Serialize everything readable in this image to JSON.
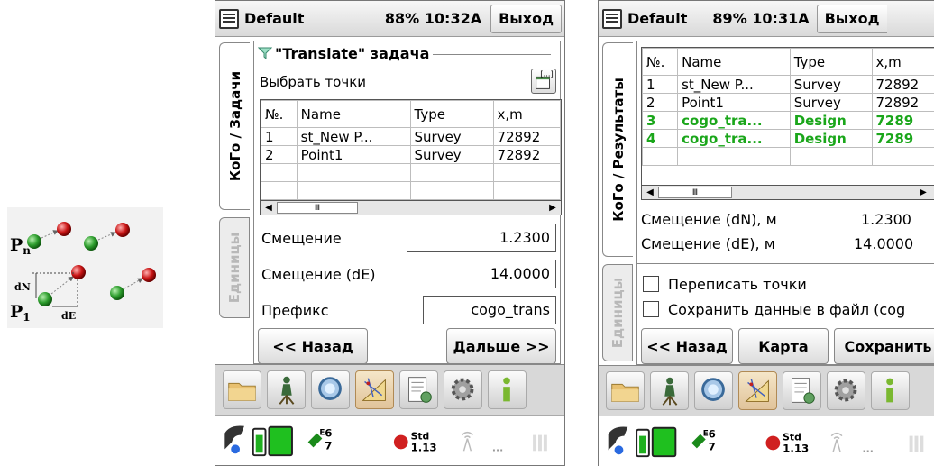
{
  "diagram": {
    "label_pn": "P",
    "label_pn_sub": "n",
    "label_p1": "P",
    "label_p1_sub": "1",
    "label_dn": "dN",
    "label_de": "dE"
  },
  "screen1": {
    "title": "Default",
    "status": "88% 10:32A",
    "exit_label": "Выход",
    "tab_active": "КоГо / Задачи",
    "tab_inactive": "Единицы",
    "group_title": "\"Translate\" задача",
    "select_label": "Выбрать точки",
    "columns": [
      "№.",
      "Name",
      "Type",
      "x,m"
    ],
    "rows": [
      {
        "no": "1",
        "name": "st_New P...",
        "type": "Survey",
        "x": "72892"
      },
      {
        "no": "2",
        "name": "Point1",
        "type": "Survey",
        "x": "72892"
      }
    ],
    "offset_label": "Смещение",
    "offset_value": "1.2300",
    "offset_de_label": "Смещение (dE)",
    "offset_de_value": "14.0000",
    "prefix_label": "Префикс",
    "prefix_value": "cogo_trans",
    "back_label": "<< Назад",
    "next_label": "Дальше >>"
  },
  "screen2": {
    "title": "Default",
    "status": "89% 10:31A",
    "exit_label": "Выход",
    "tab_active": "КоГо / Результаты",
    "tab_inactive": "Единицы",
    "columns": [
      "№.",
      "Name",
      "Type",
      "x,m"
    ],
    "rows": [
      {
        "no": "1",
        "name": "st_New P...",
        "type": "Survey",
        "x": "72892"
      },
      {
        "no": "2",
        "name": "Point1",
        "type": "Survey",
        "x": "72892"
      },
      {
        "no": "3",
        "name": "cogo_tra...",
        "type": "Design",
        "x": "7289"
      },
      {
        "no": "4",
        "name": "cogo_tra...",
        "type": "Design",
        "x": "7289"
      }
    ],
    "dn_label": "Смещение (dN), м",
    "dn_value": "1.2300",
    "de_label": "Смещение (dE), м",
    "de_value": "14.0000",
    "overwrite_label": "Переписать точки",
    "save_data_label": "Сохранить данные в файл (cog",
    "back_label": "<< Назад",
    "map_label": "Карта",
    "save_label": "Сохранить"
  },
  "statusbar": {
    "sat_e": "E",
    "sat_top": "6",
    "sat_bottom": "7",
    "std_label": "Std",
    "std_value": "1.13",
    "dots": "..."
  },
  "colors": {
    "design_green": "#1aa61a",
    "point_green": "#2e9e2e",
    "point_red": "#c81414"
  }
}
